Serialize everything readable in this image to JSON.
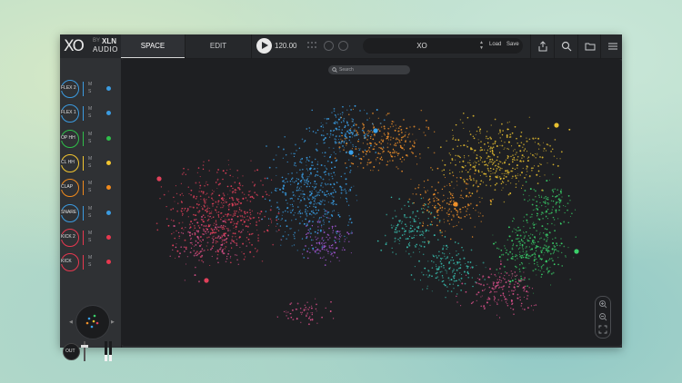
{
  "app": {
    "logo": {
      "mark": "XO",
      "by": "BY",
      "brand_top": "XLN",
      "brand_bottom": "AUDIO"
    },
    "tabs": [
      {
        "label": "SPACE",
        "active": true
      },
      {
        "label": "EDIT",
        "active": false
      }
    ],
    "transport": {
      "tempo": "120.00",
      "play_icon": "play-icon"
    },
    "preset": {
      "name": "XO",
      "load_label": "Load",
      "save_label": "Save"
    },
    "toolbar_icons": [
      "share-icon",
      "search-icon",
      "folder-icon",
      "menu-icon"
    ]
  },
  "search": {
    "placeholder": "Search"
  },
  "pads": [
    {
      "label": "FLEX 2",
      "color": "#3b9be0",
      "mute": "M",
      "solo": "S"
    },
    {
      "label": "FLEX 1",
      "color": "#3b9be0",
      "mute": "M",
      "solo": "S"
    },
    {
      "label": "OP HH",
      "color": "#2fbf4a",
      "mute": "M",
      "solo": "S"
    },
    {
      "label": "CL HH",
      "color": "#f2c530",
      "mute": "M",
      "solo": "S"
    },
    {
      "label": "CLAP",
      "color": "#f08a1c",
      "mute": "M",
      "solo": "S"
    },
    {
      "label": "SNARE",
      "color": "#3b9be0",
      "mute": "M",
      "solo": "S"
    },
    {
      "label": "KICK 2",
      "color": "#e8384f",
      "mute": "M",
      "solo": "S"
    },
    {
      "label": "KICK",
      "color": "#e8384f",
      "mute": "M",
      "solo": "S"
    }
  ],
  "output": {
    "label": "OUT",
    "level_left": 0.3,
    "level_right": 0.3
  },
  "space_palette": {
    "red": "#e0405a",
    "pink": "#d9508a",
    "purple": "#a458d8",
    "blue": "#3aa0e8",
    "teal": "#38c0b0",
    "green": "#3ad06a",
    "yellow": "#e8c030",
    "orange": "#f0902a"
  }
}
